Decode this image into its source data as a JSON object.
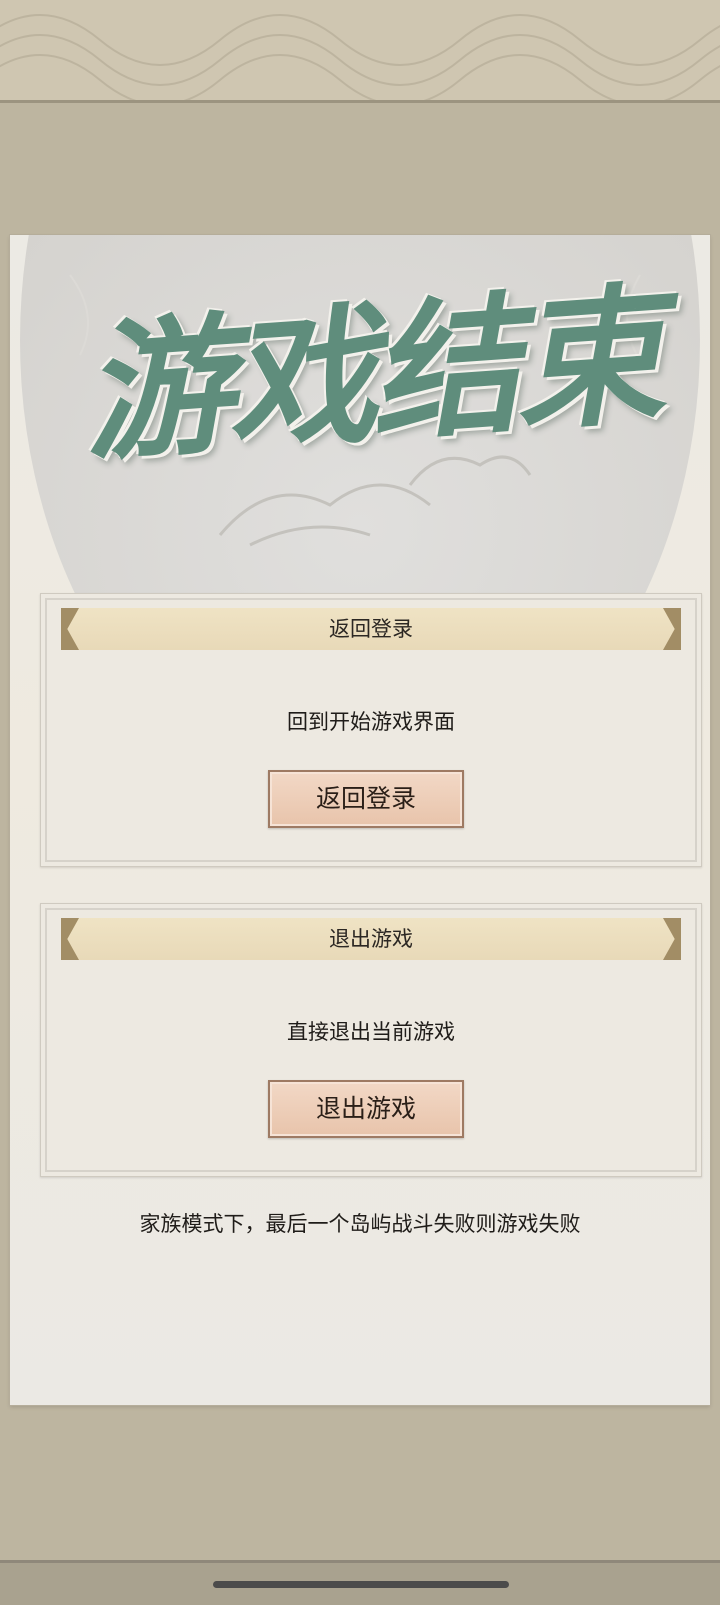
{
  "title": "游戏结束",
  "cards": [
    {
      "banner": "返回登录",
      "description": "回到开始游戏界面",
      "button_label": "返回登录"
    },
    {
      "banner": "退出游戏",
      "description": "直接退出当前游戏",
      "button_label": "退出游戏"
    }
  ],
  "footer_note": "家族模式下，最后一个岛屿战斗失败则游戏失败",
  "colors": {
    "background": "#bdb5a0",
    "panel": "#eceae4",
    "title": "#5f8d7c",
    "banner": "#ebdcbb",
    "button": "#ecccb6"
  }
}
